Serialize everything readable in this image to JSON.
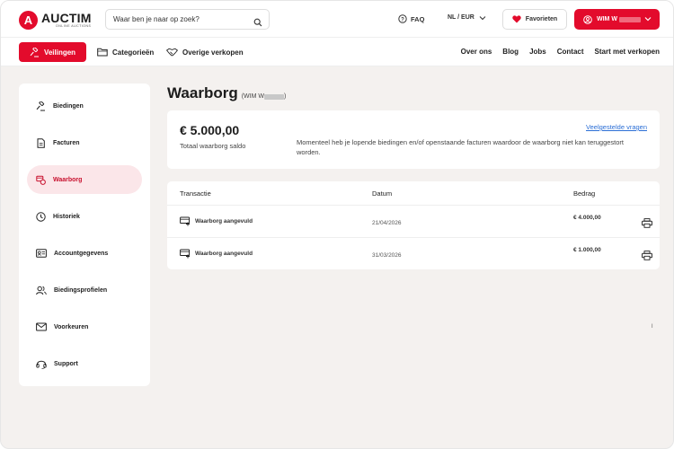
{
  "header": {
    "logo_name": "AUCTIM",
    "logo_sub": "ONLINE AUCTIONS",
    "search_placeholder": "Waar ben je naar op zoek?",
    "faq_label": "FAQ",
    "lang_label": "NL / EUR",
    "favorites_label": "Favorieten",
    "user_label": "WIM W"
  },
  "nav": {
    "primary_label": "Veilingen",
    "left_items": [
      {
        "label": "Categorieën",
        "icon": "folder-icon"
      },
      {
        "label": "Overige verkopen",
        "icon": "handshake-icon"
      }
    ],
    "right_items": [
      "Over ons",
      "Blog",
      "Jobs",
      "Contact",
      "Start met verkopen"
    ]
  },
  "sidebar": {
    "items": [
      {
        "label": "Biedingen",
        "icon": "gavel-icon",
        "active": false
      },
      {
        "label": "Facturen",
        "icon": "invoice-icon",
        "active": false
      },
      {
        "label": "Waarborg",
        "icon": "deposit-icon",
        "active": true
      },
      {
        "label": "Historiek",
        "icon": "clock-icon",
        "active": false
      },
      {
        "label": "Accountgegevens",
        "icon": "id-card-icon",
        "active": false
      },
      {
        "label": "Biedingsprofielen",
        "icon": "users-icon",
        "active": false
      },
      {
        "label": "Voorkeuren",
        "icon": "mail-icon",
        "active": false
      },
      {
        "label": "Support",
        "icon": "headset-icon",
        "active": false
      }
    ]
  },
  "page": {
    "title": "Waarborg",
    "subtitle_prefix": "(WIM W",
    "subtitle_suffix": ")"
  },
  "balance": {
    "amount": "€ 5.000,00",
    "label": "Totaal waarborg saldo",
    "faq_link": "Veelgestelde vragen",
    "notice": "Momenteel heb je lopende biedingen en/of openstaande facturen waardoor de waarborg niet kan teruggestort worden."
  },
  "transactions": {
    "headers": {
      "transaction": "Transactie",
      "date": "Datum",
      "amount": "Bedrag"
    },
    "rows": [
      {
        "label": "Waarborg aangevuld",
        "date": "21/04/2026",
        "amount": "€ 4.000,00"
      },
      {
        "label": "Waarborg aangevuld",
        "date": "31/03/2026",
        "amount": "€ 1.000,00"
      }
    ]
  },
  "misc": {
    "corner_mark": "ǀ"
  },
  "colors": {
    "brand": "#e30b2c",
    "active_bg": "#fbe6e9",
    "link": "#2c6fd6"
  }
}
